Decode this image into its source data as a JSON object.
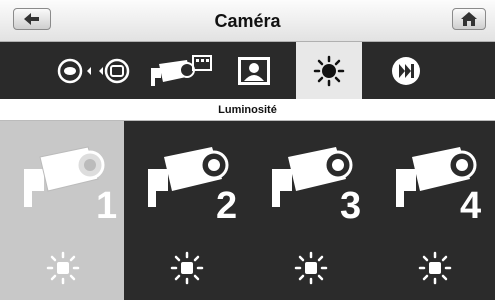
{
  "window": {
    "title": "Caméra"
  },
  "header": {
    "back_icon": "back-arrow-icon",
    "home_icon": "home-icon"
  },
  "toolbar": {
    "items": [
      {
        "icon": "camera-switch-icon"
      },
      {
        "icon": "camera-recording-icon"
      },
      {
        "icon": "contact-portrait-icon"
      },
      {
        "icon": "brightness-icon",
        "active": true
      },
      {
        "icon": "channel-skip-icon"
      }
    ]
  },
  "section": {
    "label": "Luminosité"
  },
  "cameras": [
    {
      "number": "1",
      "selected": true
    },
    {
      "number": "2",
      "selected": false
    },
    {
      "number": "3",
      "selected": false
    },
    {
      "number": "4",
      "selected": false
    }
  ],
  "colors": {
    "accent_selected": "#c8c8c8",
    "background": "#2b2b2b"
  }
}
